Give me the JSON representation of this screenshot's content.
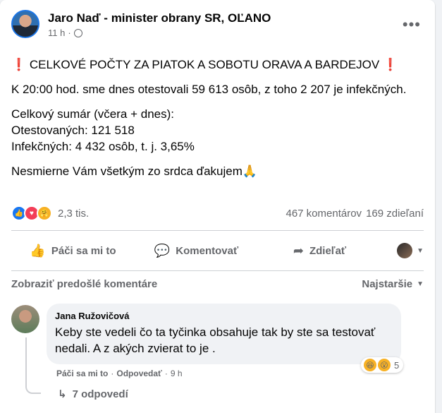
{
  "post": {
    "author": "Jaro Naď - minister obrany SR, OĽANO",
    "time": "11 h",
    "more": "•••",
    "excl": "❗",
    "headline": "CELKOVÉ POČTY ZA PIATOK A SOBOTU ORAVA A BARDEJOV",
    "p1": "K 20:00 hod. sme dnes otestovali 59 613 osôb, z toho 2 207 je infekčných.",
    "p2_line1": "Celkový sumár (včera + dnes):",
    "p2_line2": "Otestovaných: 121 518",
    "p2_line3": "Infekčných: 4 432 osôb, t. j. 3,65%",
    "p3": "Nesmierne Vám všetkým zo srdca ďakujem🙏"
  },
  "stats": {
    "reactions": "2,3 tis.",
    "comments": "467 komentárov",
    "shares": "169 zdieľaní"
  },
  "actions": {
    "like": "Páči sa mi to",
    "comment": "Komentovať",
    "share": "Zdieľať"
  },
  "comments_bar": {
    "previous": "Zobraziť predošlé komentáre",
    "sort": "Najstaršie"
  },
  "comment": {
    "name": "Jana Ružovičová",
    "text": "Keby ste vedeli čo ta tyčinka obsahuje tak by ste sa testovať nedali. A z akých zvierat to je .",
    "like": "Páči sa mi to",
    "reply": "Odpovedať",
    "time": "9 h",
    "sep": "·",
    "reaction_count": "5",
    "replies": "7 odpovedí"
  },
  "icons": {
    "like": "👍",
    "comment": "💬",
    "share": "➦",
    "reply_arrow": "↳",
    "caret": "▼"
  }
}
